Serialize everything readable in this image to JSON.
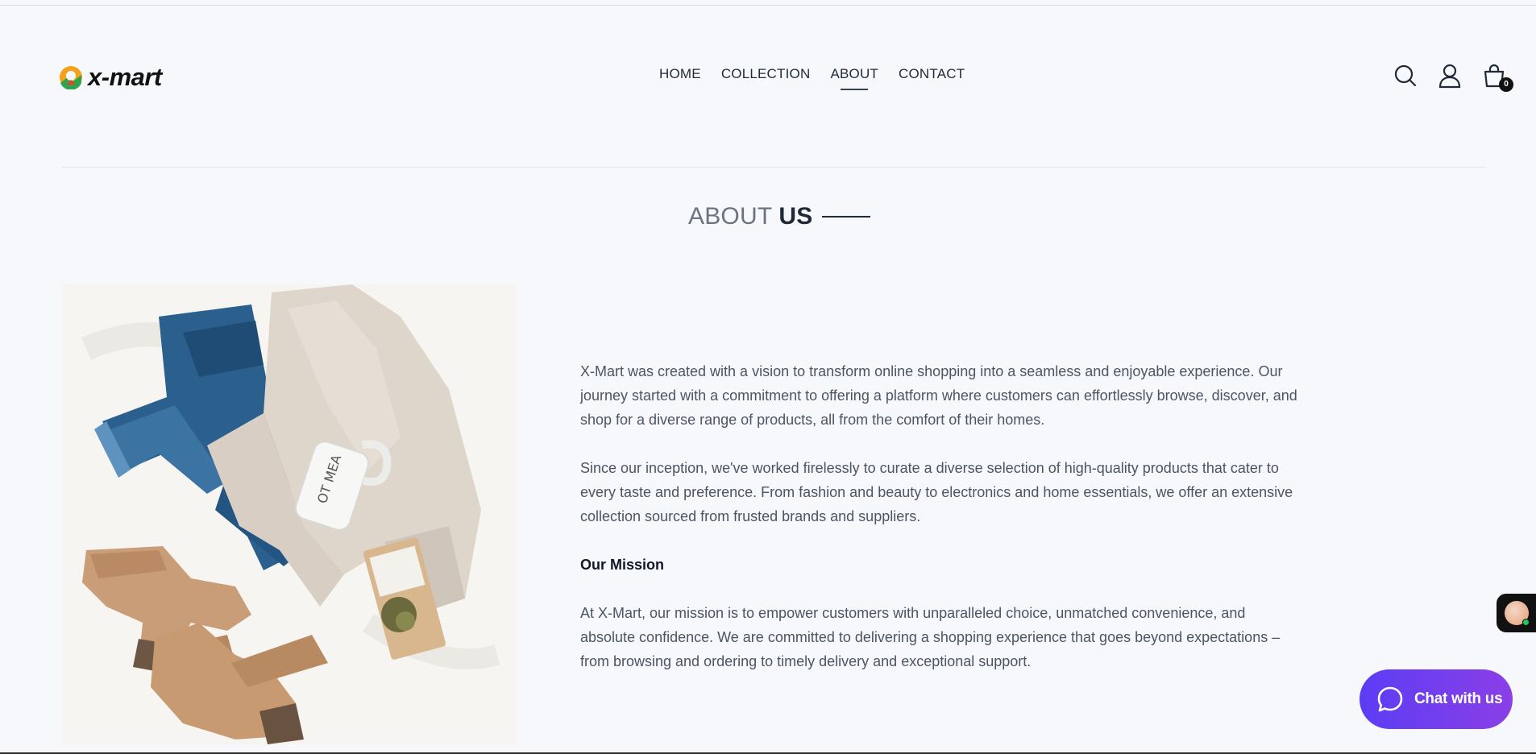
{
  "brand": {
    "name": "x-mart"
  },
  "nav": {
    "items": [
      {
        "label": "HOME"
      },
      {
        "label": "COLLECTION"
      },
      {
        "label": "ABOUT"
      },
      {
        "label": "CONTACT"
      }
    ],
    "active": "ABOUT"
  },
  "header_icons": [
    "search-icon",
    "user-icon",
    "shopping-bag-icon"
  ],
  "cart": {
    "count": "0"
  },
  "about": {
    "title_light": "ABOUT",
    "title_bold": "US",
    "paragraph1": "X-Mart was created with a vision to transform online shopping into a seamless and enjoyable experience. Our journey started with a commitment to offering a platform where customers can effortlessly browse, discover, and shop for a diverse range of products, all from the comfort of their homes.",
    "paragraph2": "Since our inception, we've worked firelessly to curate a diverse selection of high-quality products that cater to every taste and preference. From fashion and beauty to electronics and home essentials, we offer an extensive collection sourced from frusted brands and suppliers.",
    "mission_heading": "Our Mission",
    "mission_text": "At X-Mart, our mission is to empower customers with unparalleled choice, unmatched convenience, and absolute confidence. We are committed to delivering a shopping experience that goes beyond expectations – from browsing and ordering to timely delivery and exceptional support."
  },
  "chat": {
    "label": "Chat with us"
  },
  "colors": {
    "accent": "#5b3df5",
    "accent_end": "#8b3fe6",
    "text": "#374151",
    "background": "#f7f8fb"
  }
}
